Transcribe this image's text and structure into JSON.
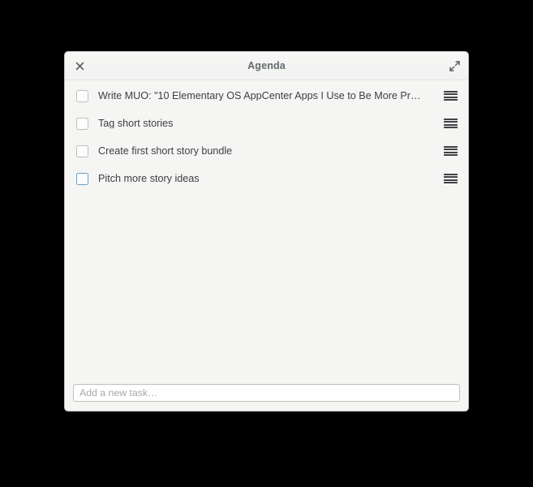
{
  "window": {
    "title": "Agenda",
    "close_icon": "close-icon",
    "maximize_icon": "maximize-icon"
  },
  "tasks": [
    {
      "label": "Write MUO: \"10 Elementary OS AppCenter Apps I Use to Be More Pr…",
      "checked": false,
      "focused": false,
      "handle_icon": "drag-handle-icon"
    },
    {
      "label": "Tag short stories",
      "checked": false,
      "focused": false,
      "handle_icon": "drag-handle-icon"
    },
    {
      "label": "Create first short story bundle",
      "checked": false,
      "focused": false,
      "handle_icon": "drag-handle-icon"
    },
    {
      "label": "Pitch more story ideas",
      "checked": false,
      "focused": true,
      "handle_icon": "drag-handle-icon"
    }
  ],
  "new_task": {
    "value": "",
    "placeholder": "Add a new task…"
  },
  "colors": {
    "window_background": "#f5f5f4",
    "titlebar_text": "#62696d",
    "task_text": "#3c4043",
    "focus_border": "#6d9dc5",
    "placeholder_text": "#a8a9a6",
    "desktop_background": "#000000"
  }
}
